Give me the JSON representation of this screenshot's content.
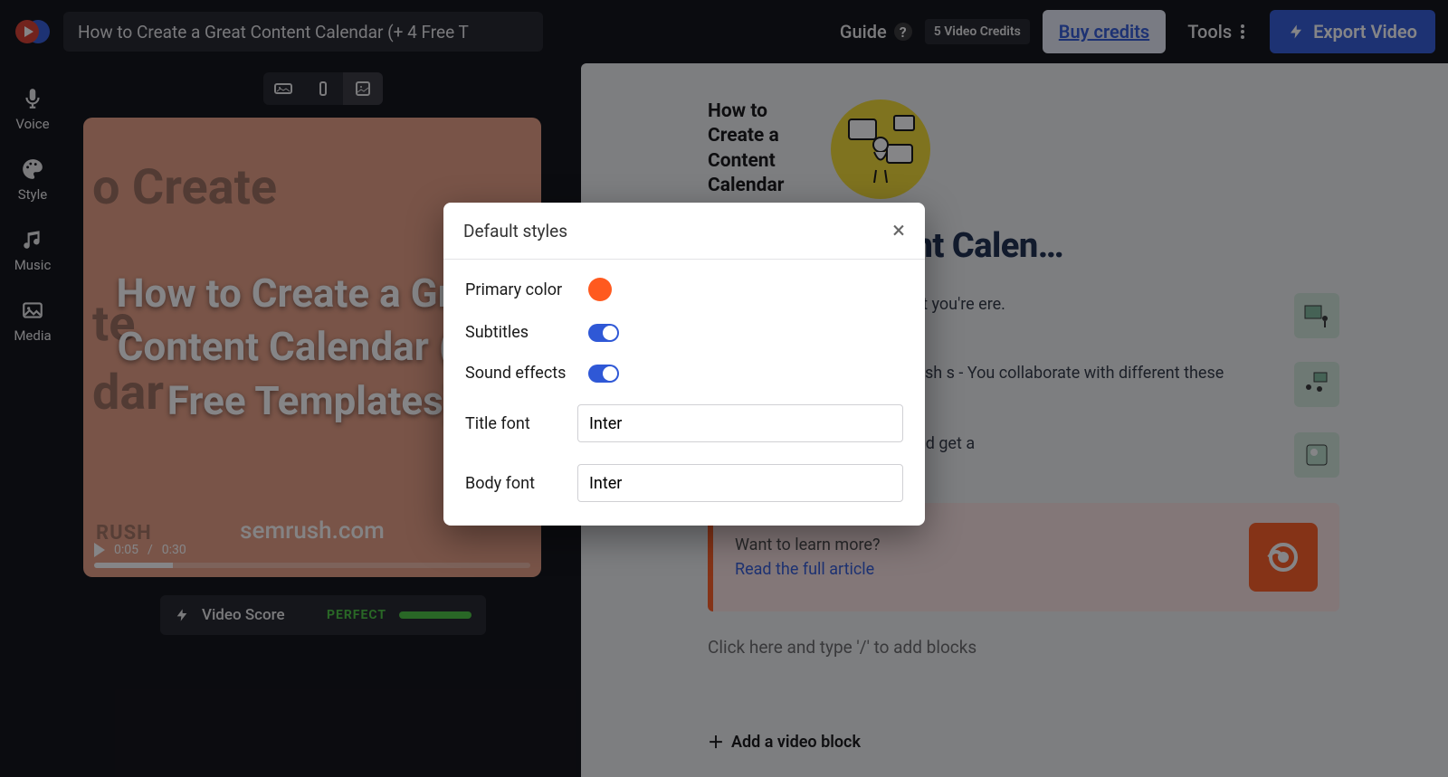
{
  "header": {
    "title_value": "How to Create a Great Content Calendar (+ 4 Free T",
    "guide": "Guide",
    "credits_badge": "5 Video Credits",
    "buy": "Buy credits",
    "tools": "Tools",
    "export": "Export Video"
  },
  "sidebar": {
    "items": [
      {
        "label": "Voice",
        "icon": "mic-icon"
      },
      {
        "label": "Style",
        "icon": "palette-icon"
      },
      {
        "label": "Music",
        "icon": "music-icon"
      },
      {
        "label": "Media",
        "icon": "media-icon"
      }
    ]
  },
  "preview": {
    "bg_line1": "o Create",
    "bg_line2": "te",
    "bg_line3": "dar",
    "overlay_title": "How to Create a Great Content Calendar (+ 4 Free Templates)",
    "time_current": "0:05",
    "time_total": "0:30",
    "watermark": "semrush.com",
    "corner": "RUSH",
    "score_label": "Video Score",
    "score_rating": "PERFECT"
  },
  "right": {
    "hero_title": "How to Create a Content Calendar",
    "heading": "a Great Content Calen…",
    "items": [
      "e that helps you organize what you're ere.",
      "alendar if: - You regularly publish s - You collaborate with different these content pieces.",
      "al media content calendars and get a"
    ],
    "cta_line1": "Want to learn more?",
    "cta_link": "Read the full article",
    "add_hint": "Click here and type '/' to add blocks",
    "add_block": "Add a video block"
  },
  "modal": {
    "title": "Default styles",
    "primary_color_label": "Primary color",
    "primary_color": "#ff5a1f",
    "subtitles_label": "Subtitles",
    "subtitles_on": true,
    "sfx_label": "Sound effects",
    "sfx_on": true,
    "title_font_label": "Title font",
    "title_font": "Inter",
    "body_font_label": "Body font",
    "body_font": "Inter"
  }
}
